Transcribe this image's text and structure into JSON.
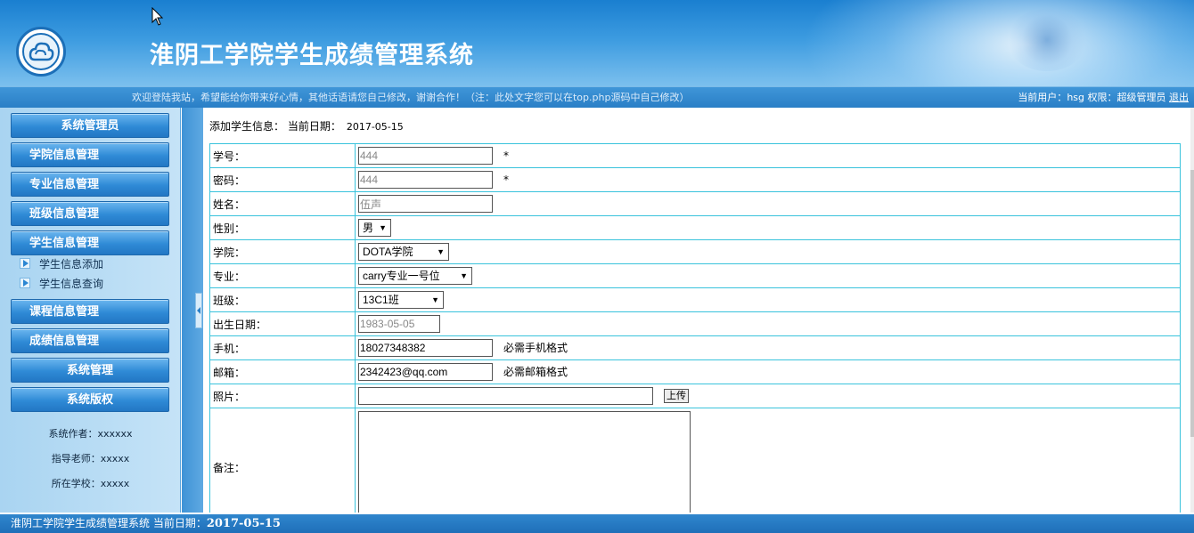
{
  "header": {
    "title": "淮阴工学院学生成绩管理系统"
  },
  "infobar": {
    "welcome": "欢迎登陆我站，希望能给你带来好心情，其他话语请您自己修改，谢谢合作！（注：此处文字您可以在top.php源码中自己修改）",
    "user_label": "当前用户：",
    "user": "hsg",
    "role_label": "权限：",
    "role": "超级管理员",
    "logout": "退出"
  },
  "sidebar": {
    "menus": [
      {
        "label": "系统管理员"
      },
      {
        "label": "学院信息管理"
      },
      {
        "label": "专业信息管理"
      },
      {
        "label": "班级信息管理"
      },
      {
        "label": "学生信息管理"
      },
      {
        "label": "课程信息管理"
      },
      {
        "label": "成绩信息管理"
      },
      {
        "label": "系统管理"
      },
      {
        "label": "系统版权"
      }
    ],
    "sub_items": [
      {
        "label": "学生信息添加"
      },
      {
        "label": "学生信息查询"
      }
    ],
    "credits": [
      {
        "text": "系统作者：xxxxxx"
      },
      {
        "text": "指导老师：xxxxx"
      },
      {
        "text": "所在学校：xxxxx"
      }
    ]
  },
  "main": {
    "heading": "添加学生信息：  当前日期：",
    "date": "2017-05-15",
    "fields": {
      "student_id": {
        "label": "学号：",
        "value": "444",
        "required": "*"
      },
      "password": {
        "label": "密码：",
        "value": "444",
        "required": "*"
      },
      "name": {
        "label": "姓名：",
        "value": "伍声"
      },
      "gender": {
        "label": "性别：",
        "value": "男"
      },
      "college": {
        "label": "学院：",
        "value": "DOTA学院"
      },
      "major": {
        "label": "专业：",
        "value": "carry专业一号位"
      },
      "class": {
        "label": "班级：",
        "value": "13C1班"
      },
      "birthday": {
        "label": "出生日期：",
        "value": "1983-05-05"
      },
      "phone": {
        "label": "手机：",
        "value": "18027348382",
        "hint": "必需手机格式"
      },
      "email": {
        "label": "邮箱：",
        "value": "2342423@qq.com",
        "hint": "必需邮箱格式"
      },
      "photo": {
        "label": "照片：",
        "value": "",
        "button": "上传"
      },
      "notes": {
        "label": "备注：",
        "value": ""
      }
    }
  },
  "footer": {
    "text": "淮阴工学院学生成绩管理系统 当前日期：",
    "date": "2017-05-15"
  },
  "colors": {
    "header_blue": "#1a7fd0",
    "menu_blue": "#2f8ad6",
    "table_border": "#39c3dc",
    "footer_blue": "#2f86cd"
  }
}
